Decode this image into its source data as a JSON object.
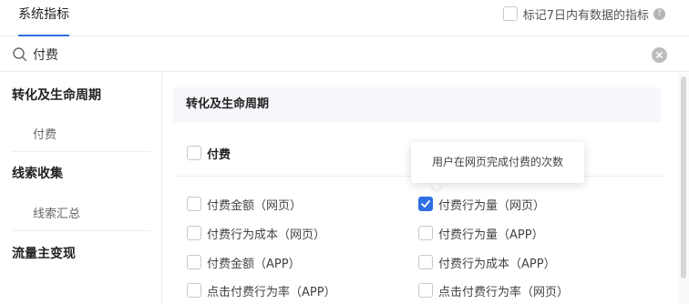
{
  "tabs": {
    "active_label": "系统指标"
  },
  "mark_recent": {
    "label": "标记7日内有数据的指标",
    "checked": false,
    "help_icon": "question-circle-icon",
    "help_glyph": "?"
  },
  "search": {
    "value": "付费",
    "placeholder": "",
    "search_icon": "search-icon",
    "clear_icon": "close-circle-icon"
  },
  "sidebar": {
    "groups": [
      {
        "label": "转化及生命周期",
        "items": [
          "付费"
        ]
      },
      {
        "label": "线索收集",
        "items": [
          "线索汇总"
        ]
      },
      {
        "label": "流量主变现",
        "items": []
      }
    ]
  },
  "main": {
    "section_title": "转化及生命周期",
    "group_checkbox": {
      "label": "付费",
      "checked": false
    },
    "metrics": [
      {
        "label": "付费金额（网页）",
        "checked": false
      },
      {
        "label": "付费行为量（网页）",
        "checked": true
      },
      {
        "label": "付费行为成本（网页）",
        "checked": false
      },
      {
        "label": "付费行为量（APP）",
        "checked": false
      },
      {
        "label": "付费金额（APP）",
        "checked": false
      },
      {
        "label": "付费行为成本（APP）",
        "checked": false
      },
      {
        "label": "点击付费行为率（APP）",
        "checked": false
      },
      {
        "label": "点击付费行为率（网页）",
        "checked": false
      }
    ]
  },
  "tooltip": {
    "text": "用户在网页完成付费的次数"
  },
  "colors": {
    "accent": "#2f6fe4",
    "border": "#ebebeb",
    "header_bg": "#f5f7fa"
  }
}
